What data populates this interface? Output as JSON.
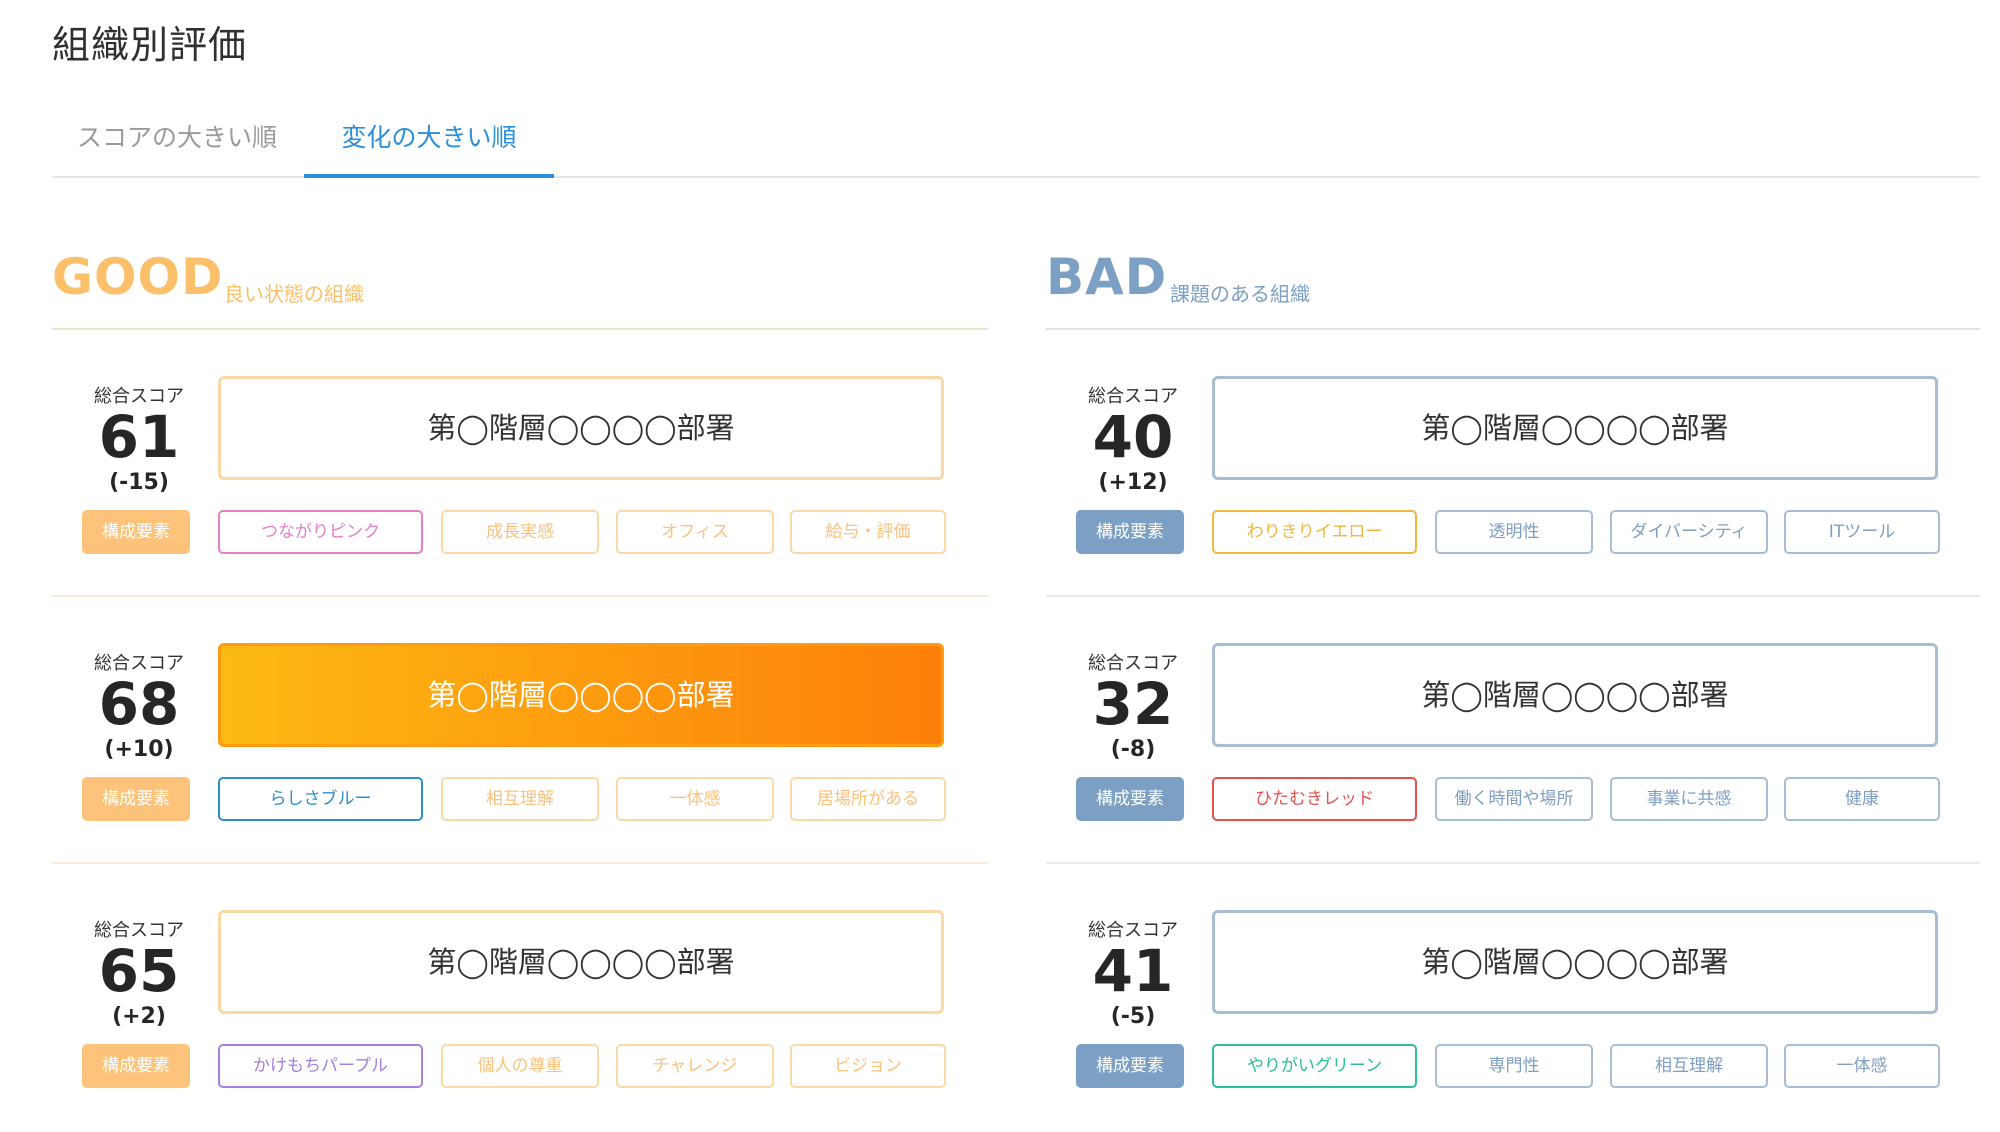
{
  "page": {
    "title": "組織別評価"
  },
  "tabs": [
    {
      "label": "スコアの大きい順",
      "active": false
    },
    {
      "label": "変化の大きい順",
      "active": true
    }
  ],
  "colors": {
    "good_accent": "#fcc06a",
    "bad_accent": "#7c9fc4",
    "tab_active": "#2b8fd9",
    "active_gradient_start": "#fdba13",
    "active_gradient_end": "#fd7f0a"
  },
  "good": {
    "heading": "GOOD",
    "subheading": "良い状態の組織",
    "cards": [
      {
        "score_label": "総合スコア",
        "score": "61",
        "diff": "(-15)",
        "department": "第◯階層◯◯◯◯部署",
        "active": false,
        "tag_label": "構成要素",
        "tags": [
          {
            "text": "つながりピンク",
            "color": "#e67fc8"
          },
          {
            "text": "成長実感"
          },
          {
            "text": "オフィス"
          },
          {
            "text": "給与・評価"
          }
        ]
      },
      {
        "score_label": "総合スコア",
        "score": "68",
        "diff": "(+10)",
        "department": "第◯階層◯◯◯◯部署",
        "active": true,
        "tag_label": "構成要素",
        "tags": [
          {
            "text": "らしさブルー",
            "color": "#2a8fd0"
          },
          {
            "text": "相互理解"
          },
          {
            "text": "一体感"
          },
          {
            "text": "居場所がある"
          }
        ]
      },
      {
        "score_label": "総合スコア",
        "score": "65",
        "diff": "(+2)",
        "department": "第◯階層◯◯◯◯部署",
        "active": false,
        "tag_label": "構成要素",
        "tags": [
          {
            "text": "かけもちパープル",
            "color": "#a67fe0"
          },
          {
            "text": "個人の尊重"
          },
          {
            "text": "チャレンジ"
          },
          {
            "text": "ビジョン"
          }
        ]
      }
    ]
  },
  "bad": {
    "heading": "BAD",
    "subheading": "課題のある組織",
    "cards": [
      {
        "score_label": "総合スコア",
        "score": "40",
        "diff": "(+12)",
        "department": "第◯階層◯◯◯◯部署",
        "active": false,
        "tag_label": "構成要素",
        "tags": [
          {
            "text": "わりきりイエロー",
            "color": "#f4b63d"
          },
          {
            "text": "透明性"
          },
          {
            "text": "ダイバーシティ"
          },
          {
            "text": "ITツール"
          }
        ]
      },
      {
        "score_label": "総合スコア",
        "score": "32",
        "diff": "(-8)",
        "department": "第◯階層◯◯◯◯部署",
        "active": false,
        "tag_label": "構成要素",
        "tags": [
          {
            "text": "ひたむきレッド",
            "color": "#e8504e"
          },
          {
            "text": "働く時間や場所"
          },
          {
            "text": "事業に共感"
          },
          {
            "text": "健康"
          }
        ]
      },
      {
        "score_label": "総合スコア",
        "score": "41",
        "diff": "(-5)",
        "department": "第◯階層◯◯◯◯部署",
        "active": false,
        "tag_label": "構成要素",
        "tags": [
          {
            "text": "やりがいグリーン",
            "color": "#2fbf9a"
          },
          {
            "text": "専門性"
          },
          {
            "text": "相互理解"
          },
          {
            "text": "一体感"
          }
        ]
      }
    ]
  }
}
